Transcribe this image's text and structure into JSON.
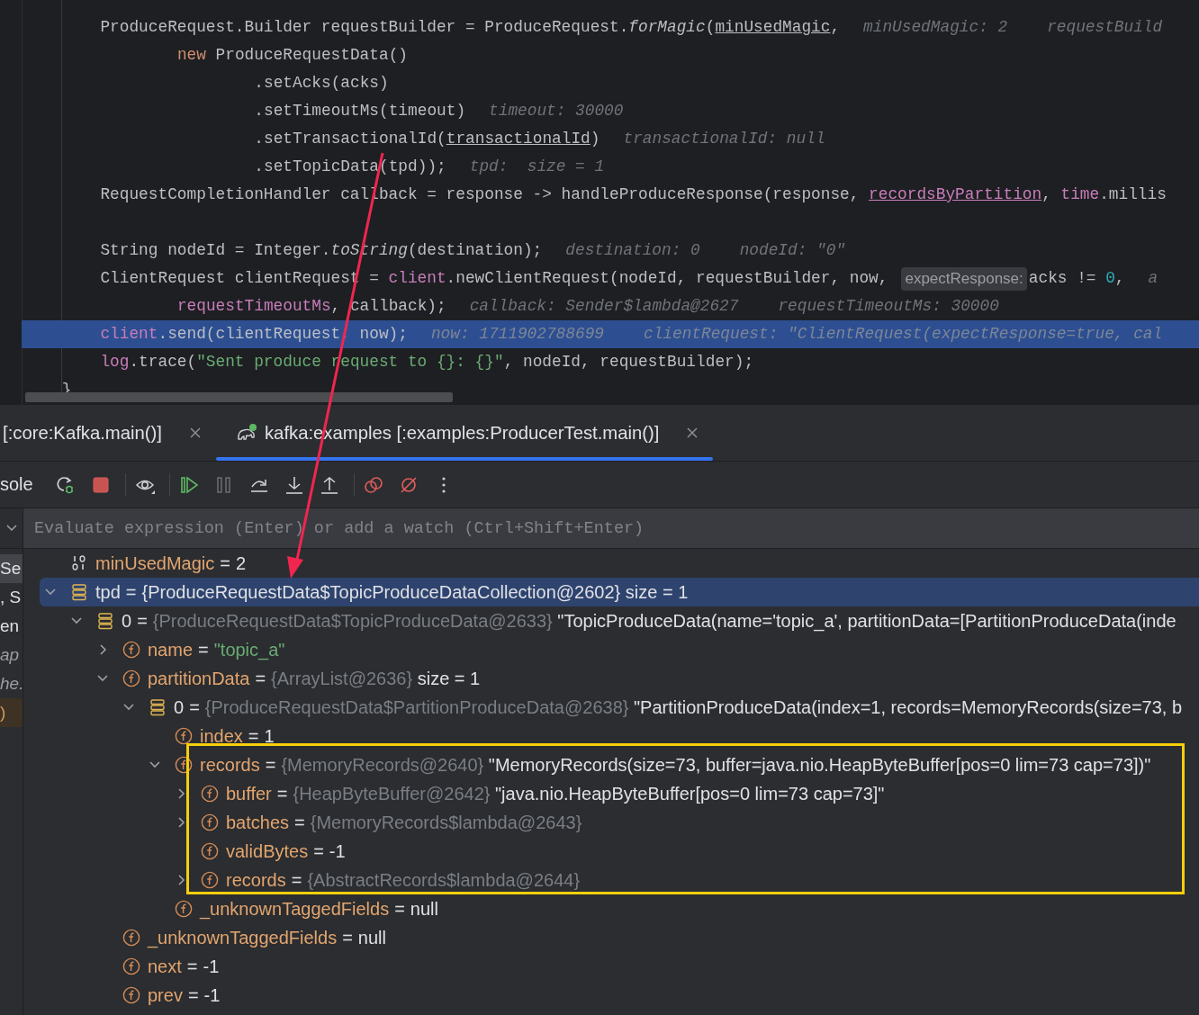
{
  "editor": {
    "lines": [
      {
        "current": false,
        "segments": [
          {
            "kind": "code",
            "tokens": [
              {
                "kind": "plain",
                "text": "ProduceRequest.Builder requestBuilder = ProduceRequest."
              },
              {
                "kind": "static",
                "text": "forMagic"
              },
              {
                "kind": "plain",
                "text": "("
              },
              {
                "kind": "underline",
                "text": "minUsedMagic"
              },
              {
                "kind": "plain",
                "text": ","
              }
            ]
          },
          {
            "kind": "hint",
            "text": "minUsedMagic: 2"
          },
          {
            "kind": "hint",
            "text": "requestBuild"
          }
        ]
      },
      {
        "current": false,
        "segments": [
          {
            "kind": "code",
            "tokens": [
              {
                "kind": "keyword",
                "text": "new"
              },
              {
                "kind": "plain",
                "text": " ProduceRequestData()"
              }
            ]
          }
        ]
      },
      {
        "current": false,
        "segments": [
          {
            "kind": "code",
            "tokens": [
              {
                "kind": "plain",
                "text": ".setAcks(acks)"
              }
            ]
          }
        ]
      },
      {
        "current": false,
        "segments": [
          {
            "kind": "code",
            "tokens": [
              {
                "kind": "plain",
                "text": ".setTimeoutMs(timeout)"
              }
            ]
          },
          {
            "kind": "hint",
            "text": "timeout: 30000"
          }
        ]
      },
      {
        "current": false,
        "segments": [
          {
            "kind": "code",
            "tokens": [
              {
                "kind": "plain",
                "text": ".setTransactionalId("
              },
              {
                "kind": "underline",
                "text": "transactionalId"
              },
              {
                "kind": "plain",
                "text": ")"
              }
            ]
          },
          {
            "kind": "hint",
            "text": "transactionalId: null"
          }
        ]
      },
      {
        "current": false,
        "segments": [
          {
            "kind": "code",
            "tokens": [
              {
                "kind": "plain",
                "text": ".setTopicData(tpd));"
              }
            ]
          },
          {
            "kind": "hint",
            "text": "tpd:  size = 1"
          }
        ]
      },
      {
        "current": false,
        "segments": [
          {
            "kind": "code",
            "tokens": [
              {
                "kind": "plain",
                "text": "RequestCompletionHandler callback = response -> handleProduceResponse(response, "
              },
              {
                "kind": "field-underline",
                "text": "recordsByPartition"
              },
              {
                "kind": "plain",
                "text": ", "
              },
              {
                "kind": "field",
                "text": "time"
              },
              {
                "kind": "plain",
                "text": ".millis"
              }
            ]
          }
        ]
      },
      {
        "current": false
      },
      {
        "current": false,
        "segments": [
          {
            "kind": "code",
            "tokens": [
              {
                "kind": "plain",
                "text": "String nodeId = Integer."
              },
              {
                "kind": "static",
                "text": "toString"
              },
              {
                "kind": "plain",
                "text": "(destination);"
              }
            ]
          },
          {
            "kind": "hint",
            "text": "destination: 0"
          },
          {
            "kind": "hint",
            "text": "nodeId: \"0\""
          }
        ]
      },
      {
        "current": false,
        "segments": [
          {
            "kind": "code",
            "tokens": [
              {
                "kind": "plain",
                "text": "ClientRequest clientRequest = "
              },
              {
                "kind": "field",
                "text": "client"
              },
              {
                "kind": "plain",
                "text": ".newClientRequest(nodeId, requestBuilder, now,"
              }
            ]
          },
          {
            "kind": "inlay",
            "text": "expectResponse:"
          },
          {
            "kind": "code",
            "tokens": [
              {
                "kind": "plain",
                "text": "acks != "
              },
              {
                "kind": "number",
                "text": "0"
              },
              {
                "kind": "plain",
                "text": ","
              }
            ]
          },
          {
            "kind": "hint",
            "text": "a"
          }
        ]
      },
      {
        "current": false,
        "segments": [
          {
            "kind": "code",
            "tokens": [
              {
                "kind": "field",
                "text": "requestTimeoutMs"
              },
              {
                "kind": "plain",
                "text": ", callback);"
              }
            ]
          },
          {
            "kind": "hint",
            "text": "callback: Sender$lambda@2627"
          },
          {
            "kind": "hint",
            "text": "requestTimeoutMs: 30000"
          }
        ]
      },
      {
        "current": true,
        "segments": [
          {
            "kind": "code",
            "tokens": [
              {
                "kind": "field",
                "text": "client"
              },
              {
                "kind": "plain",
                "text": ".send(clientRequest, now);"
              }
            ]
          },
          {
            "kind": "hint",
            "text": "now: 1711902788699"
          },
          {
            "kind": "hint",
            "text": "clientRequest: \"ClientRequest(expectResponse=true, cal"
          }
        ]
      },
      {
        "current": false,
        "segments": [
          {
            "kind": "code",
            "tokens": [
              {
                "kind": "field",
                "text": "log"
              },
              {
                "kind": "plain",
                "text": ".trace("
              },
              {
                "kind": "string",
                "text": "\"Sent produce request to {}: {}\""
              },
              {
                "kind": "plain",
                "text": ", nodeId, requestBuilder);"
              }
            ]
          }
        ]
      },
      {
        "current": false,
        "segments": [
          {
            "kind": "code",
            "tokens": [
              {
                "kind": "plain",
                "text": "}"
              }
            ]
          }
        ]
      }
    ]
  },
  "tabs": [
    {
      "label": "[:core:Kafka.main()]",
      "selected": false
    },
    {
      "label": "kafka:examples [:examples:ProducerTest.main()]",
      "selected": true
    }
  ],
  "toolbar": {
    "tab_label": "sole",
    "buttons": [
      {
        "kind": "rerun",
        "disabled": false
      },
      {
        "kind": "stop",
        "disabled": false
      },
      {
        "kind": "separator"
      },
      {
        "kind": "watch",
        "disabled": false
      },
      {
        "kind": "separator"
      },
      {
        "kind": "resume",
        "disabled": false
      },
      {
        "kind": "pause",
        "disabled": true
      },
      {
        "kind": "step-over",
        "disabled": false
      },
      {
        "kind": "step-into",
        "disabled": false
      },
      {
        "kind": "step-out",
        "disabled": false
      },
      {
        "kind": "separator"
      },
      {
        "kind": "breakpoints",
        "disabled": false
      },
      {
        "kind": "mute",
        "disabled": false
      },
      {
        "kind": "more",
        "disabled": false
      }
    ]
  },
  "evaluate": {
    "placeholder": "Evaluate expression (Enter) or add a watch (Ctrl+Shift+Enter)"
  },
  "frames": [
    {
      "text": "Se",
      "kind": "normal",
      "selected": true
    },
    {
      "text": ", S",
      "kind": "normal",
      "selected": false
    },
    {
      "text": "en",
      "kind": "normal",
      "selected": false
    },
    {
      "text": "ap",
      "kind": "library",
      "selected": false
    },
    {
      "text": "he.",
      "kind": "library",
      "selected": false
    },
    {
      "text": ")",
      "kind": "marked",
      "selected": false
    }
  ],
  "variables": [
    {
      "kind": "primitive",
      "name": "minUsedMagic",
      "op": "=",
      "value": "2",
      "selected": false
    },
    {
      "kind": "collection",
      "name": "tpd",
      "op": "=",
      "type": "{ProduceRequestData$TopicProduceDataCollection@2602}",
      "value": "size = 1",
      "expanded": true,
      "selected": true,
      "children": [
        {
          "kind": "collection",
          "name": "0",
          "op": "=",
          "type": "{ProduceRequestData$TopicProduceData@2633}",
          "value": "\"TopicProduceData(name='topic_a', partitionData=[PartitionProduceData(inde",
          "expanded": true,
          "selected": false,
          "children": [
            {
              "kind": "field",
              "name": "name",
              "op": "=",
              "string_value": "\"topic_a\"",
              "expanded": false,
              "selected": false
            },
            {
              "kind": "field",
              "name": "partitionData",
              "op": "=",
              "type": "{ArrayList@2636}",
              "value": "size = 1",
              "expanded": true,
              "selected": false,
              "children": [
                {
                  "kind": "collection",
                  "name": "0",
                  "op": "=",
                  "type": "{ProduceRequestData$PartitionProduceData@2638}",
                  "value": "\"PartitionProduceData(index=1, records=MemoryRecords(size=73, b",
                  "expanded": true,
                  "selected": false,
                  "children": [
                    {
                      "kind": "field",
                      "name": "index",
                      "op": "=",
                      "value": "1",
                      "selected": false
                    },
                    {
                      "kind": "field",
                      "name": "records",
                      "op": "=",
                      "type": "{MemoryRecords@2640}",
                      "value": "\"MemoryRecords(size=73, buffer=java.nio.HeapByteBuffer[pos=0 lim=73 cap=73])\"",
                      "expanded": true,
                      "selected": false,
                      "children": [
                        {
                          "kind": "field",
                          "name": "buffer",
                          "op": "=",
                          "type": "{HeapByteBuffer@2642}",
                          "value": "\"java.nio.HeapByteBuffer[pos=0 lim=73 cap=73]\"",
                          "expanded": false,
                          "selected": false
                        },
                        {
                          "kind": "field",
                          "name": "batches",
                          "op": "=",
                          "type": "{MemoryRecords$lambda@2643}",
                          "expanded": false,
                          "selected": false
                        },
                        {
                          "kind": "field",
                          "name": "validBytes",
                          "op": "=",
                          "value": "-1",
                          "selected": false
                        },
                        {
                          "kind": "field",
                          "name": "records",
                          "op": "=",
                          "type": "{AbstractRecords$lambda@2644}",
                          "expanded": false,
                          "selected": false
                        }
                      ]
                    },
                    {
                      "kind": "field",
                      "name": "_unknownTaggedFields",
                      "op": "=",
                      "value": "null",
                      "selected": false
                    }
                  ]
                }
              ]
            },
            {
              "kind": "field",
              "name": "_unknownTaggedFields",
              "op": "=",
              "value": "null",
              "selected": false
            },
            {
              "kind": "field",
              "name": "next",
              "op": "=",
              "value": "-1",
              "selected": false
            },
            {
              "kind": "field",
              "name": "prev",
              "op": "=",
              "value": "-1",
              "selected": false
            }
          ]
        }
      ]
    }
  ]
}
